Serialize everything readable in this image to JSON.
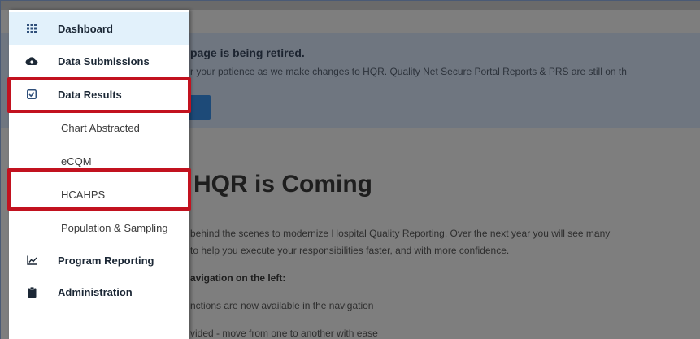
{
  "banner": {
    "title": "page is being retired.",
    "text": "r your patience as we make changes to HQR. Quality Net Secure Portal Reports & PRS are still on th"
  },
  "main": {
    "headline": "HQR is Coming",
    "para1_line1": "behind the scenes to modernize Hospital Quality Reporting. Over the next year you will see many",
    "para1_line2": "to help you execute your responsibilities faster, and with more confidence.",
    "nav_heading": "avigation on the left:",
    "bullet1": "nctions are now available in the navigation",
    "bullet2": "vided - move from one to another with ease"
  },
  "sidebar": {
    "items": [
      {
        "label": "Dashboard",
        "icon": "grid-icon"
      },
      {
        "label": "Data Submissions",
        "icon": "cloud-upload-icon"
      },
      {
        "label": "Data Results",
        "icon": "checkbox-icon"
      },
      {
        "label": "Chart Abstracted"
      },
      {
        "label": "eCQM"
      },
      {
        "label": "HCAHPS"
      },
      {
        "label": "Population & Sampling"
      },
      {
        "label": "Program Reporting",
        "icon": "line-chart-icon"
      },
      {
        "label": "Administration",
        "icon": "clipboard-icon"
      }
    ]
  },
  "colors": {
    "highlight": "#c2121f",
    "active_bg": "#e2f1fb",
    "nav_text": "#1b2735"
  }
}
